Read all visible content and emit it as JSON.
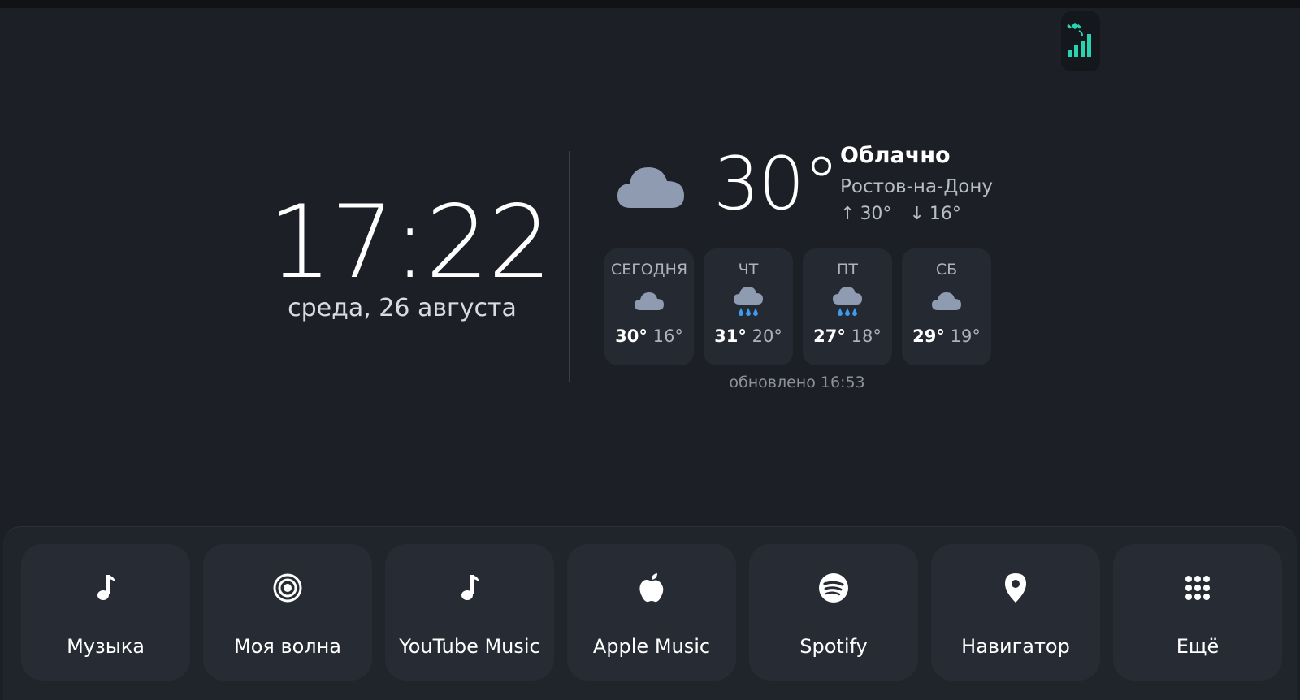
{
  "clock": {
    "time": "17:22",
    "date": "среда, 26 августа"
  },
  "weather": {
    "current": {
      "temp": "30°",
      "condition": "Облачно",
      "city": "Ростов-на-Дону",
      "high": "30°",
      "low": "16°",
      "icon": "cloud-icon"
    },
    "forecast": [
      {
        "day": "СЕГОДНЯ",
        "hi": "30°",
        "lo": "16°",
        "icon": "cloud-icon"
      },
      {
        "day": "ЧТ",
        "hi": "31°",
        "lo": "20°",
        "icon": "rain-cloud-icon"
      },
      {
        "day": "ПТ",
        "hi": "27°",
        "lo": "18°",
        "icon": "rain-cloud-icon"
      },
      {
        "day": "СБ",
        "hi": "29°",
        "lo": "19°",
        "icon": "cloud-icon"
      }
    ],
    "updated": "обновлено 16:53"
  },
  "status": {
    "icon": "signal-icon",
    "accent_color": "#2ad3b0"
  },
  "dock": {
    "items": [
      {
        "label": "Музыка",
        "icon": "music-note-icon"
      },
      {
        "label": "Моя волна",
        "icon": "wave-icon"
      },
      {
        "label": "YouTube Music",
        "icon": "music-note-icon"
      },
      {
        "label": "Apple Music",
        "icon": "apple-icon"
      },
      {
        "label": "Spotify",
        "icon": "spotify-icon"
      },
      {
        "label": "Навигатор",
        "icon": "location-pin-icon"
      },
      {
        "label": "Ещё",
        "icon": "app-grid-icon"
      }
    ]
  },
  "colors": {
    "background": "#1c1f26",
    "card": "#252932",
    "rain": "#3d9bf0",
    "cloud": "#8e9bb0"
  }
}
